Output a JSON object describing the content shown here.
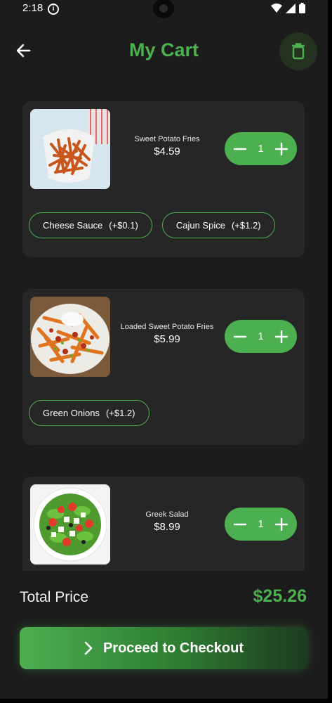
{
  "status_bar": {
    "time": "2:18"
  },
  "header": {
    "title": "My Cart"
  },
  "cart": [
    {
      "name": "Sweet Potato Fries",
      "price": "$4.59",
      "quantity": "1",
      "image": "sweet-potato-fries-photo",
      "addons": [
        {
          "name": "Cheese Sauce",
          "price": "(+$0.1)"
        },
        {
          "name": "Cajun Spice",
          "price": "(+$1.2)"
        }
      ]
    },
    {
      "name": "Loaded Sweet Potato Fries",
      "price": "$5.99",
      "quantity": "1",
      "image": "loaded-fries-photo",
      "addons": [
        {
          "name": "Green Onions",
          "price": "(+$1.2)"
        }
      ]
    },
    {
      "name": "Greek Salad",
      "price": "$8.99",
      "quantity": "1",
      "image": "greek-salad-photo",
      "addons": []
    }
  ],
  "footer": {
    "total_label": "Total Price",
    "total_value": "$25.26",
    "checkout_label": "Proceed to Checkout"
  },
  "colors": {
    "accent": "#4caf50",
    "background": "#1c1c1c",
    "card": "#262626"
  }
}
